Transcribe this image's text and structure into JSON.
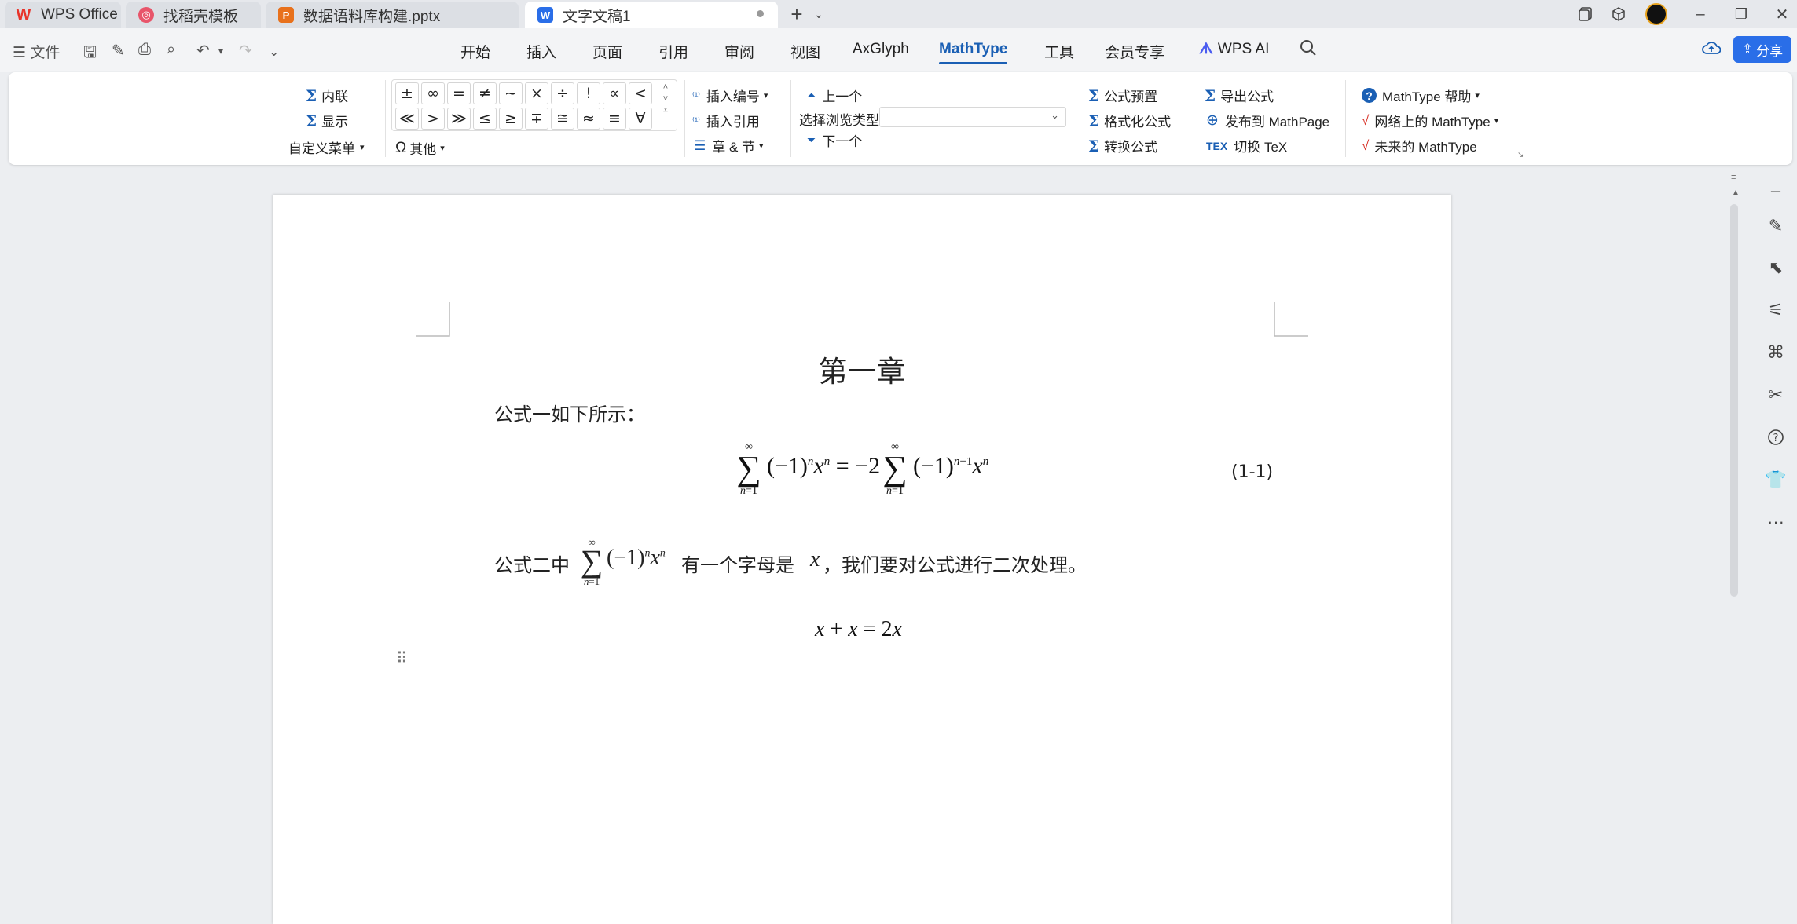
{
  "tabs": [
    {
      "label": "WPS Office",
      "icon": "wps-logo-icon"
    },
    {
      "label": "找稻壳模板",
      "icon": "daoke-icon"
    },
    {
      "label": "数据语料库构建.pptx",
      "icon": "pptx-icon"
    },
    {
      "label": "文字文稿1",
      "icon": "word-doc-icon"
    }
  ],
  "menubar": {
    "file_label": "文件",
    "items": [
      "开始",
      "插入",
      "页面",
      "引用",
      "审阅",
      "视图",
      "AxGlyph",
      "MathType",
      "工具",
      "会员专享",
      "WPS AI"
    ],
    "active": "MathType",
    "share_label": "分享"
  },
  "ribbon": {
    "inline_label": "内联",
    "display_label": "显示",
    "custom_menu_label": "自定义菜单",
    "symbols_row1": [
      "±",
      "∞",
      "=",
      "≠",
      "~",
      "×",
      "÷",
      "!",
      "∝",
      "<"
    ],
    "symbols_row2": [
      "≪",
      ">",
      "≫",
      "≤",
      "≥",
      "∓",
      "≅",
      "≈",
      "≡",
      "∀"
    ],
    "other_label": "其他",
    "insert_number_label": "插入编号",
    "insert_ref_label": "插入引用",
    "chapter_section_label": "章 & 节",
    "prev_label": "上一个",
    "browse_type_label": "选择浏览类型",
    "next_label": "下一个",
    "preset_label": "公式预置",
    "format_label": "格式化公式",
    "convert_label": "转换公式",
    "export_label": "导出公式",
    "publish_label": "发布到 MathPage",
    "toggle_tex_label": "切换 TeX",
    "help_label": "MathType 帮助",
    "online_label": "网络上的 MathType",
    "future_label": "未来的 MathType"
  },
  "document": {
    "heading": "第一章",
    "para1": "公式一如下所示：",
    "eq1_number": "(1-1)",
    "para2_prefix": "公式二中",
    "para2_mid": "有一个字母是",
    "para2_var": "x",
    "para2_suffix": "，我们要对公式进行二次处理。"
  },
  "colors": {
    "accent": "#1a5fb4",
    "wps_red": "#e8332a"
  }
}
